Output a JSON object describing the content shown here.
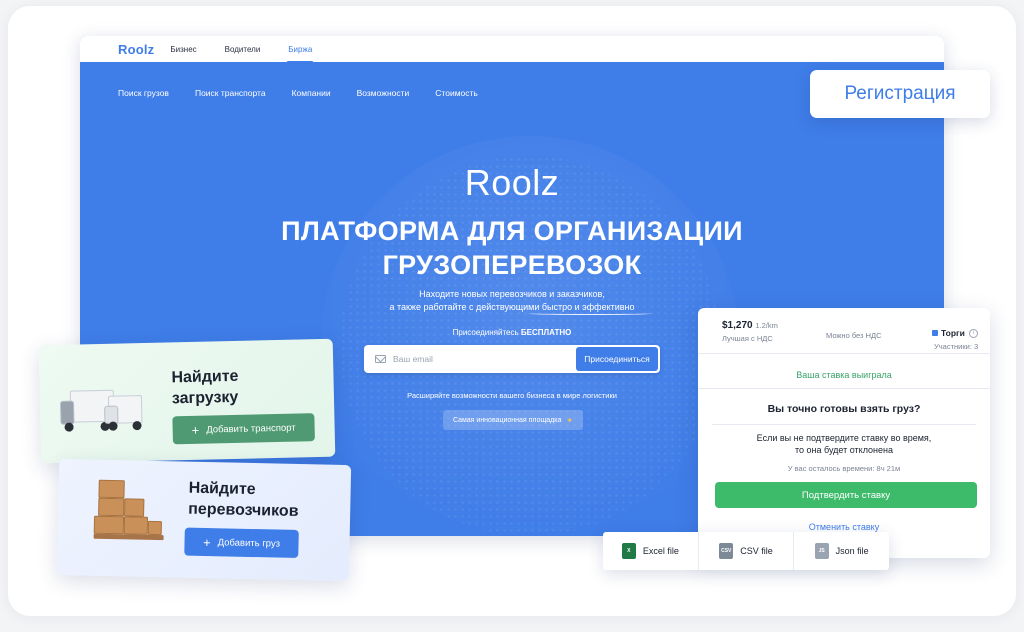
{
  "topbar": {
    "brand": "Roolz",
    "nav": [
      "Бизнес",
      "Водители",
      "Биржа"
    ],
    "active_index": 2
  },
  "mainnav": [
    "Поиск грузов",
    "Поиск транспорта",
    "Компании",
    "Возможности",
    "Стоимость"
  ],
  "hero": {
    "logo": "Roolz",
    "title_line1": "ПЛАТФОРМА ДЛЯ ОРГАНИЗАЦИИ",
    "title_line2": "ГРУЗОПЕРЕВОЗОК",
    "subtitle_line1": "Находите новых перевозчиков и заказчиков,",
    "subtitle_line2": "а также работайте с действующими быстро и эффективно",
    "join_prefix": "Присоединяйтесь ",
    "join_free": "БЕСПЛАТНО",
    "email_placeholder": "Ваш email",
    "join_button": "Присоединиться",
    "expand_text": "Расширяйте возможности вашего бизнеса в мире логистики",
    "chip_text": "Самая инновационная площадка"
  },
  "register_button": "Регистрация",
  "card_cargo": {
    "title_line1": "Найдите",
    "title_line2": "загрузку",
    "button": "Добавить транспорт"
  },
  "card_carrier": {
    "title_line1": "Найдите",
    "title_line2": "перевозчиков",
    "button": "Добавить груз"
  },
  "bid": {
    "price": "$1,270",
    "price_unit": "1.2/km",
    "best_label": "Лучшая с НДС",
    "no_vat": "Можно без НДС",
    "auction": "Торги",
    "participants": "Участники: 3",
    "won": "Ваша ставка выиграла",
    "question": "Вы точно готовы взять груз?",
    "warning_line1": "Если вы не подтвердите ставку во время,",
    "warning_line2": "то она будет отклонена",
    "timer": "У вас осталось времени: 8ч 21м",
    "confirm": "Подтвердить ставку",
    "cancel": "Отменить ставку"
  },
  "exports": [
    {
      "label": "Excel file",
      "icon": "excel-file-icon"
    },
    {
      "label": "CSV file",
      "icon": "csv-file-icon"
    },
    {
      "label": "Json file",
      "icon": "json-file-icon"
    }
  ],
  "colors": {
    "brand_blue": "#3f7de8",
    "success_green": "#3dbb6a",
    "card_green_button": "#4f9a72"
  }
}
